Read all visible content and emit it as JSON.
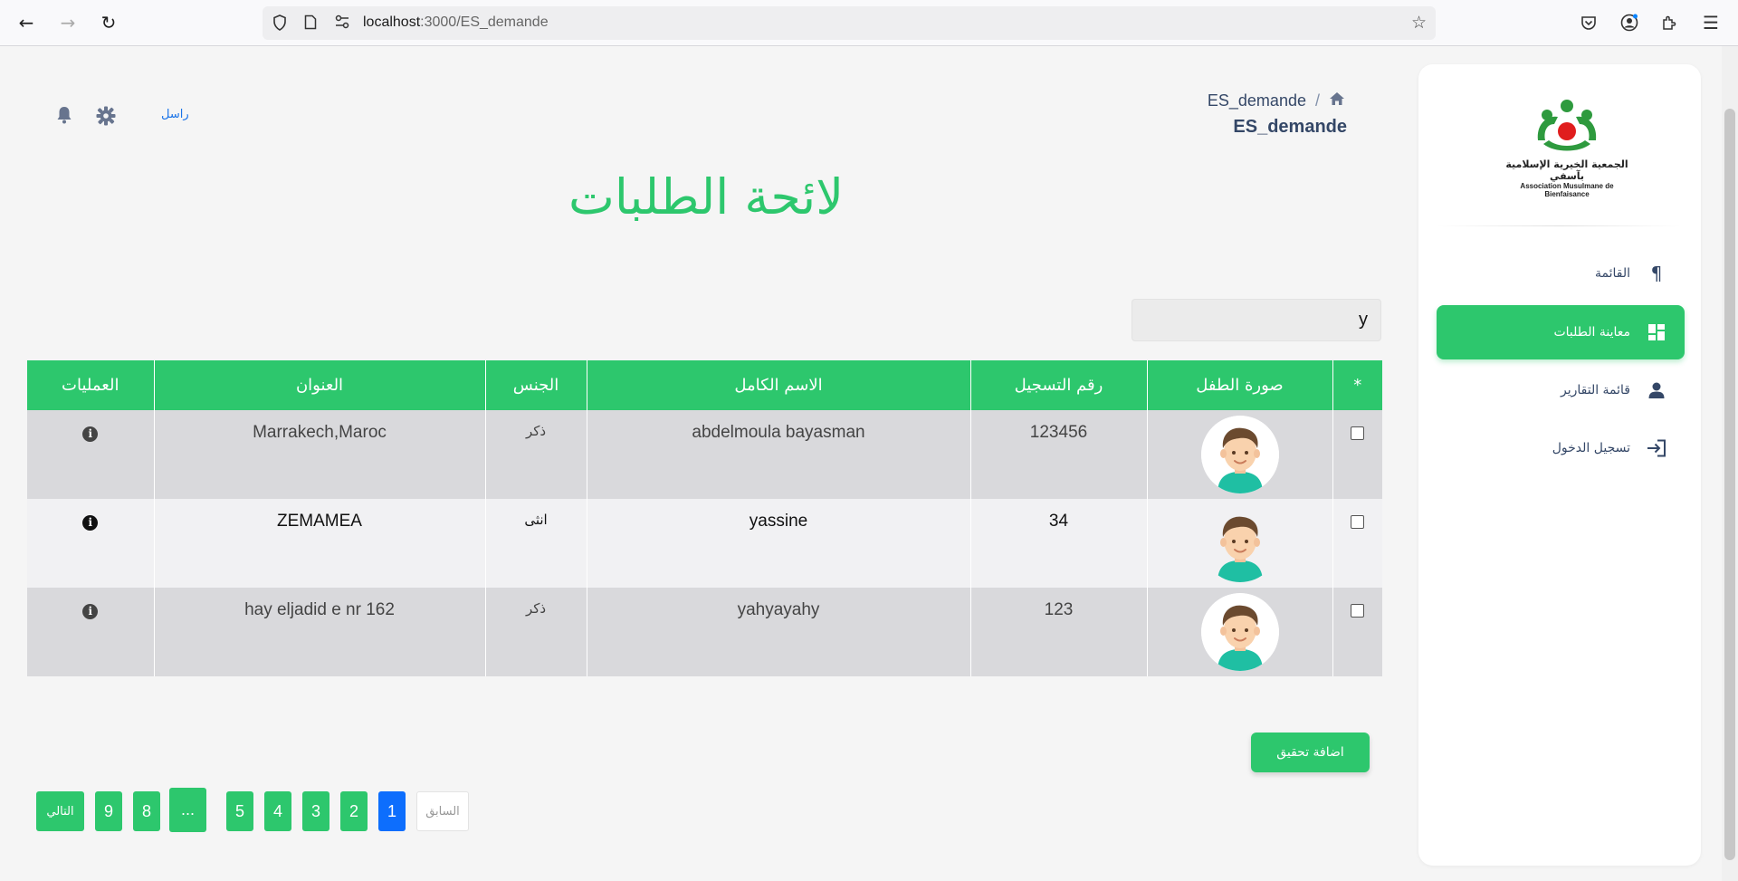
{
  "browser": {
    "url_host": "localhost",
    "url_path": ":3000/ES_demande"
  },
  "header": {
    "contact_label": "راسل",
    "breadcrumb_current": "ES_demande",
    "page_subtitle": "ES_demande",
    "page_title": "لائحة الطلبات"
  },
  "sidebar": {
    "logo_text_ar": "الجمعية الخيرية الإسلامية بآسفي",
    "logo_text_fr": "Association Musulmane de Bienfaisance",
    "items": [
      {
        "label": "القائمة",
        "icon": "paragraph-icon",
        "active": false
      },
      {
        "label": "معاينة الطلبات",
        "icon": "dashboard-icon",
        "active": true
      },
      {
        "label": "قائمة التقارير",
        "icon": "user-icon",
        "active": false
      },
      {
        "label": "تسجيل الدخول",
        "icon": "login-icon",
        "active": false
      }
    ]
  },
  "search": {
    "value": "y"
  },
  "table": {
    "headers": {
      "select": "*",
      "photo": "صورة الطفل",
      "reg_number": "رقم التسجيل",
      "full_name": "الاسم الكامل",
      "gender": "الجنس",
      "address": "العنوان",
      "actions": "العمليات"
    },
    "rows": [
      {
        "reg_number": "123456",
        "full_name": "abdelmoula bayasman",
        "gender": "ذكر",
        "address": "Marrakech,Maroc"
      },
      {
        "reg_number": "34",
        "full_name": "yassine",
        "gender": "انثى",
        "address": "ZEMAMEA"
      },
      {
        "reg_number": "123",
        "full_name": "yahyayahy",
        "gender": "ذكر",
        "address": "hay eljadid e nr 162"
      }
    ]
  },
  "actions": {
    "add_investigation": "اضافة تحقيق"
  },
  "pagination": {
    "prev": "السابق",
    "pages": [
      "1",
      "2",
      "3",
      "4",
      "5"
    ],
    "ellipsis": "...",
    "tail_pages": [
      "8",
      "9"
    ],
    "next": "التالي",
    "current": "1"
  },
  "colors": {
    "primary": "#2dc76d",
    "active_page": "#0d6efd",
    "text_dark": "#344767"
  }
}
